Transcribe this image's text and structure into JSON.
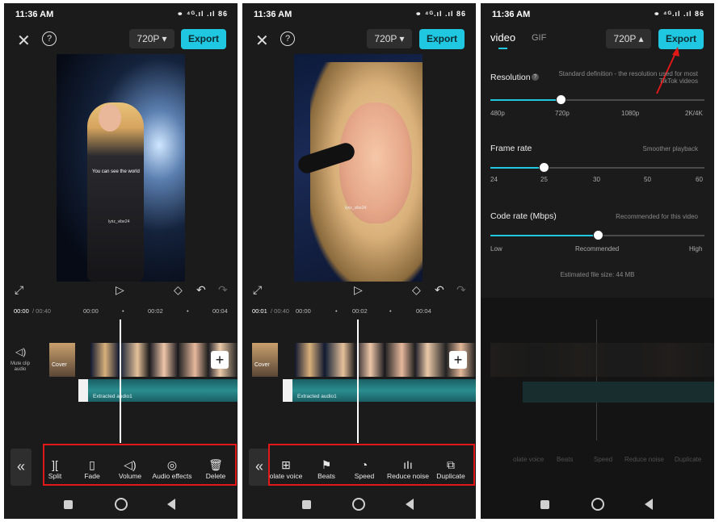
{
  "status": {
    "time": "11:36 AM",
    "icons": "⚭ ⁴ᴳ.ıl .ıl 86"
  },
  "screen1": {
    "resolution": "720P ▾",
    "export": "Export",
    "caption": "You can see the world",
    "watermark": "lyriz_vibe24",
    "time_current": "00:00",
    "time_total": "/ 00:40",
    "ticks": [
      "00:00",
      "•",
      "00:02",
      "•",
      "00:04"
    ],
    "mute_label": "Mute clip audio",
    "cover": "Cover",
    "audio_label": "Extracted audio1",
    "tools": [
      {
        "icon": "][",
        "label": "Split"
      },
      {
        "icon": "▯",
        "label": "Fade"
      },
      {
        "icon": "◁)",
        "label": "Volume"
      },
      {
        "icon": "◎",
        "label": "Audio effects"
      },
      {
        "icon": "🗑",
        "label": "Delete"
      }
    ]
  },
  "screen2": {
    "resolution": "720P ▾",
    "export": "Export",
    "watermark": "lyriz_vibe24",
    "time_current": "00:01",
    "time_total": "/ 00:40",
    "ticks": [
      "00:00",
      "•",
      "00:02",
      "•",
      "00:04"
    ],
    "cover": "Cover",
    "audio_label": "Extracted audio1",
    "tools": [
      {
        "icon": "⊞",
        "label": "olate voice"
      },
      {
        "icon": "⚑",
        "label": "Beats"
      },
      {
        "icon": "◔",
        "label": "Speed"
      },
      {
        "icon": "ıIı",
        "label": "Reduce noise"
      },
      {
        "icon": "⧉",
        "label": "Duplicate"
      }
    ]
  },
  "screen3": {
    "tab_video": "video",
    "tab_gif": "GIF",
    "resolution": "720P ▴",
    "export": "Export",
    "resolution_label": "Resolution",
    "resolution_hint": "Standard definition - the resolution used for most TikTok videos",
    "resolution_ticks": [
      "480p",
      "720p",
      "1080p",
      "2K/4K"
    ],
    "resolution_value": 0.33,
    "framerate_label": "Frame rate",
    "framerate_hint": "Smoother playback",
    "framerate_ticks": [
      "24",
      "25",
      "30",
      "50",
      "60"
    ],
    "framerate_value": 0.25,
    "coderate_label": "Code rate (Mbps)",
    "coderate_hint": "Recommended for this video",
    "coderate_ticks": [
      "Low",
      "Recommended",
      "High"
    ],
    "coderate_value": 0.5,
    "filesize": "Estimated file size: 44 MB",
    "dim_tools": [
      "olate voice",
      "Beats",
      "Speed",
      "Reduce noise",
      "Duplicate"
    ]
  },
  "colors": {
    "accent": "#1fc8e0",
    "highlight": "#e01818",
    "background": "#1b1b1b"
  }
}
